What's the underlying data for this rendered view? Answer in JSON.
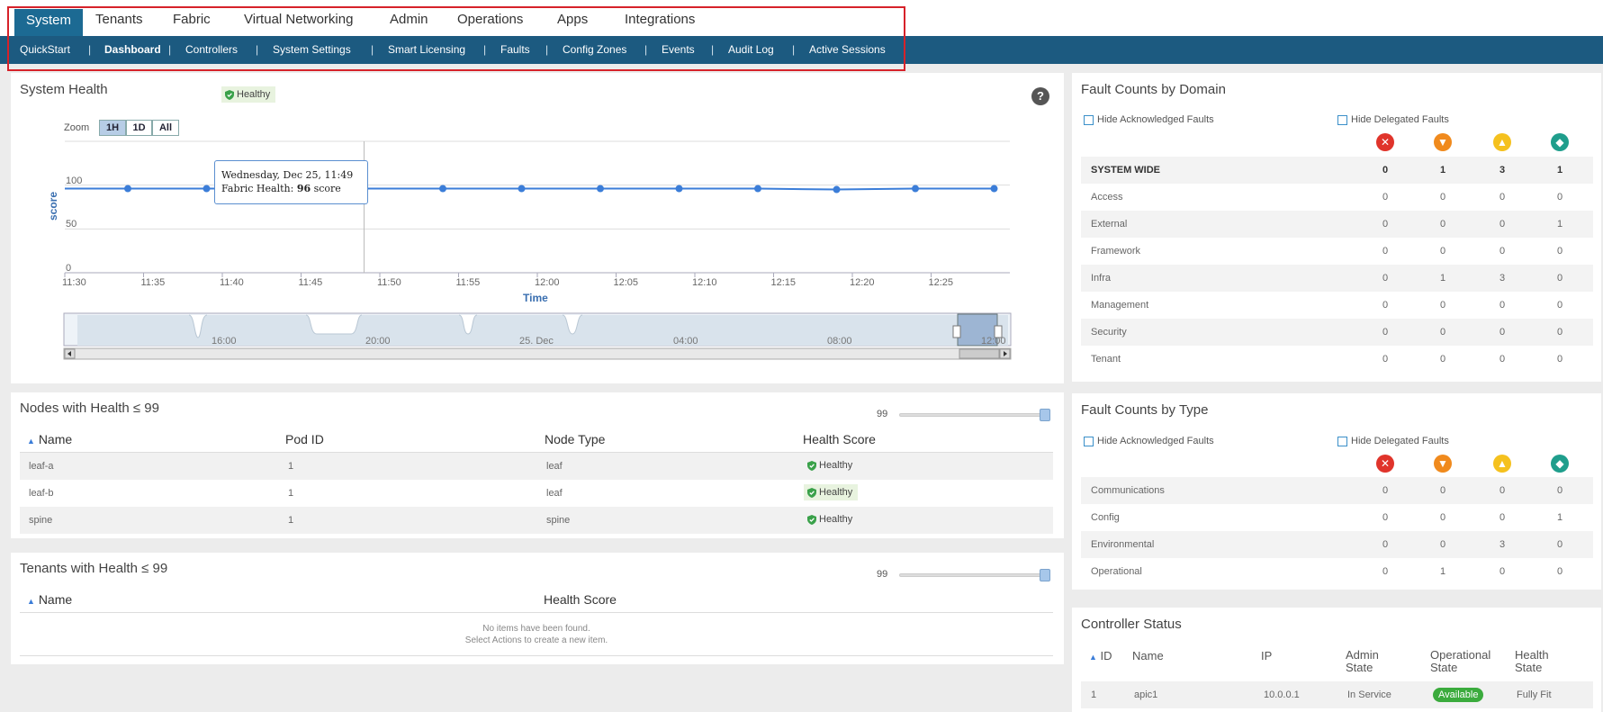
{
  "top_nav": {
    "tabs": [
      "System",
      "Tenants",
      "Fabric",
      "Virtual Networking",
      "Admin",
      "Operations",
      "Apps",
      "Integrations"
    ],
    "active": "System"
  },
  "sub_nav": {
    "items": [
      "QuickStart",
      "Dashboard",
      "Controllers",
      "System Settings",
      "Smart Licensing",
      "Faults",
      "Config Zones",
      "Events",
      "Audit Log",
      "Active Sessions"
    ],
    "active": "Dashboard"
  },
  "system_health": {
    "title": "System Health",
    "status": "Healthy",
    "help_label": "?",
    "zoom_label": "Zoom",
    "zoom_options": [
      "1H",
      "1D",
      "All"
    ],
    "zoom_selected": "1H",
    "tooltip_date": "Wednesday, Dec 25, 11:49",
    "tooltip_label": "Fabric Health:",
    "tooltip_value": "96",
    "tooltip_unit": "score",
    "navigator_labels": [
      "16:00",
      "20:00",
      "25. Dec",
      "04:00",
      "08:00",
      "12:00"
    ]
  },
  "chart_data": {
    "type": "line",
    "xlabel": "Time",
    "ylabel": "score",
    "x": [
      "11:30",
      "11:35",
      "11:40",
      "11:45",
      "11:50",
      "11:55",
      "12:00",
      "12:05",
      "12:10",
      "12:15",
      "12:20",
      "12:25"
    ],
    "x_ticks": [
      "11:30",
      "11:35",
      "11:40",
      "11:45",
      "11:50",
      "11:55",
      "12:00",
      "12:05",
      "12:10",
      "12:15",
      "12:20",
      "12:25"
    ],
    "y_ticks": [
      0,
      50,
      100
    ],
    "ylim": [
      0,
      150
    ],
    "series": [
      {
        "color": "#3b7dd8",
        "points": [
          {
            "t": "11:34",
            "v": 96
          },
          {
            "t": "11:39",
            "v": 96
          },
          {
            "t": "11:44",
            "v": 96
          },
          {
            "t": "11:49",
            "v": 96
          },
          {
            "t": "11:54",
            "v": 96
          },
          {
            "t": "11:59",
            "v": 96
          },
          {
            "t": "12:04",
            "v": 96
          },
          {
            "t": "12:09",
            "v": 96
          },
          {
            "t": "12:14",
            "v": 96
          },
          {
            "t": "12:19",
            "v": 95
          },
          {
            "t": "12:24",
            "v": 96
          },
          {
            "t": "12:29",
            "v": 96
          }
        ]
      }
    ],
    "grid": true
  },
  "nodes": {
    "title": "Nodes with Health ≤ 99",
    "slider_value": "99",
    "columns": [
      "Name",
      "Pod ID",
      "Node Type",
      "Health Score"
    ],
    "rows": [
      {
        "name": "leaf-a",
        "pod": "1",
        "type": "leaf",
        "health": "Healthy"
      },
      {
        "name": "leaf-b",
        "pod": "1",
        "type": "leaf",
        "health": "Healthy"
      },
      {
        "name": "spine",
        "pod": "1",
        "type": "spine",
        "health": "Healthy"
      }
    ]
  },
  "tenants": {
    "title": "Tenants with Health ≤ 99",
    "slider_value": "99",
    "columns": [
      "Name",
      "Health Score"
    ],
    "empty_line1": "No items have been found.",
    "empty_line2": "Select Actions to create a new item."
  },
  "fault_domain": {
    "title": "Fault Counts by Domain",
    "hide_ack": "Hide Acknowledged Faults",
    "hide_deleg": "Hide Delegated Faults",
    "rows": [
      {
        "label": "SYSTEM WIDE",
        "vals": [
          "0",
          "1",
          "3",
          "1"
        ]
      },
      {
        "label": "Access",
        "vals": [
          "0",
          "0",
          "0",
          "0"
        ]
      },
      {
        "label": "External",
        "vals": [
          "0",
          "0",
          "0",
          "1"
        ]
      },
      {
        "label": "Framework",
        "vals": [
          "0",
          "0",
          "0",
          "0"
        ]
      },
      {
        "label": "Infra",
        "vals": [
          "0",
          "1",
          "3",
          "0"
        ]
      },
      {
        "label": "Management",
        "vals": [
          "0",
          "0",
          "0",
          "0"
        ]
      },
      {
        "label": "Security",
        "vals": [
          "0",
          "0",
          "0",
          "0"
        ]
      },
      {
        "label": "Tenant",
        "vals": [
          "0",
          "0",
          "0",
          "0"
        ]
      }
    ]
  },
  "fault_type": {
    "title": "Fault Counts by Type",
    "hide_ack": "Hide Acknowledged Faults",
    "hide_deleg": "Hide Delegated Faults",
    "rows": [
      {
        "label": "Communications",
        "vals": [
          "0",
          "0",
          "0",
          "0"
        ]
      },
      {
        "label": "Config",
        "vals": [
          "0",
          "0",
          "0",
          "1"
        ]
      },
      {
        "label": "Environmental",
        "vals": [
          "0",
          "0",
          "3",
          "0"
        ]
      },
      {
        "label": "Operational",
        "vals": [
          "0",
          "1",
          "0",
          "0"
        ]
      }
    ]
  },
  "severity_colors": [
    "#e0342b",
    "#f08a1d",
    "#f5c11e",
    "#1f9e8c"
  ],
  "controller": {
    "title": "Controller Status",
    "col_id": "ID",
    "col_name": "Name",
    "col_ip": "IP",
    "col_admin_1": "Admin",
    "col_admin_2": "State",
    "col_op_1": "Operational",
    "col_op_2": "State",
    "col_health_1": "Health",
    "col_health_2": "State",
    "row": {
      "id": "1",
      "name": "apic1",
      "ip": "10.0.0.1",
      "admin": "In Service",
      "op": "Available",
      "health": "Fully Fit"
    }
  }
}
